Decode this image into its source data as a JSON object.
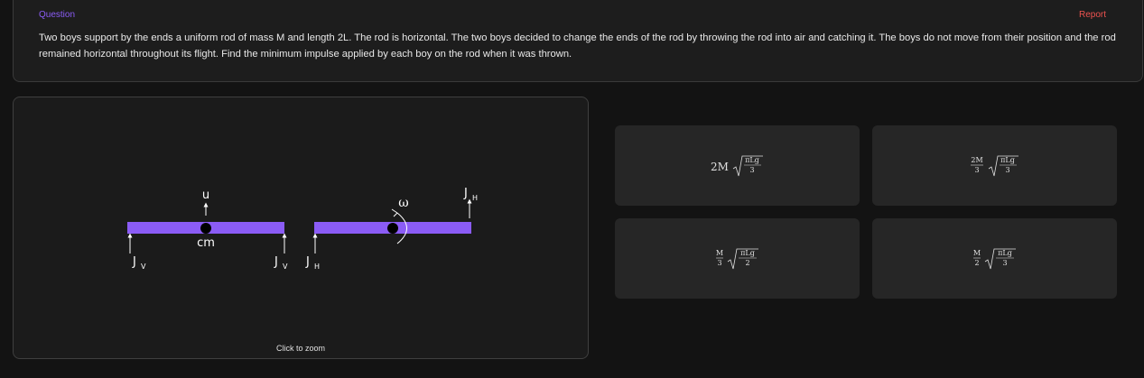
{
  "question": {
    "label": "Question",
    "report_label": "Report",
    "text": "Two boys support by the ends a uniform rod of mass M and length 2L. The rod is horizontal. The two boys decided to change the ends of the rod by throwing the rod into air and catching it. The boys do not move from their position and the rod remained horizontal throughout its flight. Find the minimum impulse applied by each boy on the rod when it was thrown."
  },
  "figure": {
    "zoom_hint": "Click to zoom",
    "rod_color": "#8b5cf6",
    "labels": {
      "u": "u",
      "cm": "cm",
      "jv": "J",
      "jh": "J",
      "sub_v": "V",
      "sub_h": "H",
      "omega": "ω"
    }
  },
  "options": [
    {
      "coef": "2M",
      "coef_num": "",
      "coef_den": "",
      "rad_num": "πLg",
      "rad_den": "3"
    },
    {
      "coef": "",
      "coef_num": "2M",
      "coef_den": "3",
      "rad_num": "πLg",
      "rad_den": "3"
    },
    {
      "coef": "",
      "coef_num": "M",
      "coef_den": "3",
      "rad_num": "πLg",
      "rad_den": "2"
    },
    {
      "coef": "",
      "coef_num": "M",
      "coef_den": "2",
      "rad_num": "πLg",
      "rad_den": "3"
    }
  ],
  "colors": {
    "accent": "#8b5cf6",
    "report": "#ef5350",
    "background": "#131313",
    "card": "#1d1d1d",
    "option_bg": "#262626"
  }
}
